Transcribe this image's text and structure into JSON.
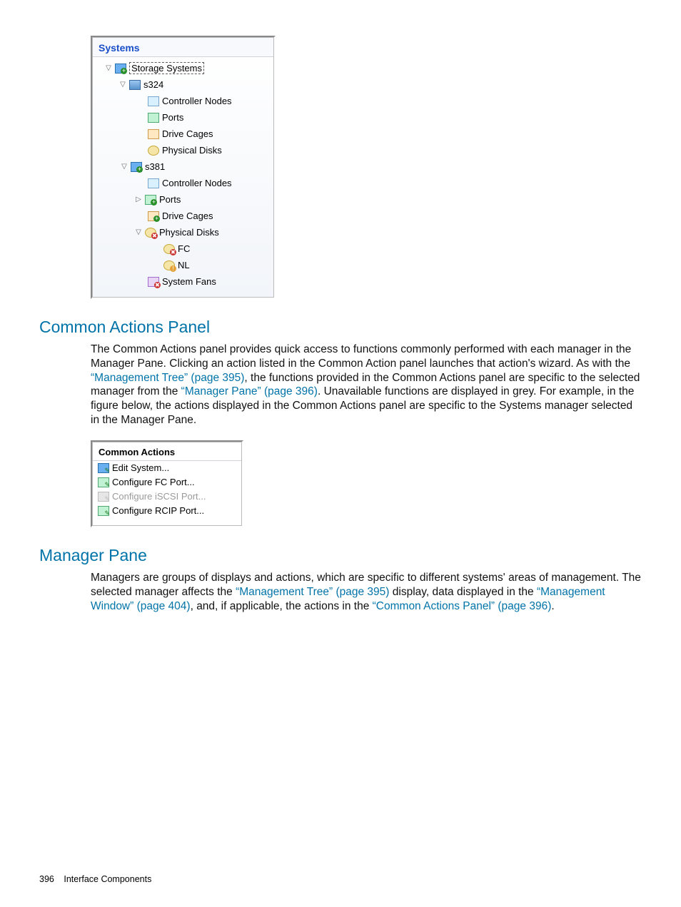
{
  "systems_panel": {
    "title": "Systems",
    "tree": {
      "root_label": "Storage Systems",
      "s324": {
        "label": "s324",
        "controller": "Controller Nodes",
        "ports": "Ports",
        "cages": "Drive Cages",
        "disks": "Physical Disks"
      },
      "s381": {
        "label": "s381",
        "controller": "Controller Nodes",
        "ports": "Ports",
        "cages": "Drive Cages",
        "disks": "Physical Disks",
        "fc": "FC",
        "nl": "NL",
        "fans": "System Fans"
      }
    }
  },
  "section1": {
    "heading": "Common Actions Panel",
    "p1a": "The Common Actions panel provides quick access to functions commonly performed with each manager in the Manager Pane. Clicking an action listed in the Common Action panel launches that action's wizard. As with the ",
    "link1": "“Management Tree” (page 395)",
    "p1b": ", the functions provided in the Common Actions panel are specific to the selected manager from the ",
    "link2": "“Manager Pane” (page 396)",
    "p1c": ". Unavailable functions are displayed in grey. For example, in the figure below, the actions displayed in the Common Actions panel are specific to the Systems manager selected in the Manager Pane."
  },
  "common_actions": {
    "title": "Common Actions",
    "items": [
      {
        "label": "Edit System...",
        "enabled": true
      },
      {
        "label": "Configure FC Port...",
        "enabled": true
      },
      {
        "label": "Configure iSCSI Port...",
        "enabled": false
      },
      {
        "label": "Configure RCIP Port...",
        "enabled": true
      }
    ]
  },
  "section2": {
    "heading": "Manager Pane",
    "p1a": "Managers are groups of displays and actions, which are specific to different systems' areas of management. The selected manager affects the ",
    "link1": "“Management Tree” (page 395)",
    "p1b": " display, data displayed in the ",
    "link2": "“Management Window” (page 404)",
    "p1c": ", and, if applicable, the actions in the ",
    "link3": "“Common Actions Panel” (page 396)",
    "p1d": "."
  },
  "footer": {
    "page": "396",
    "section": "Interface Components"
  }
}
